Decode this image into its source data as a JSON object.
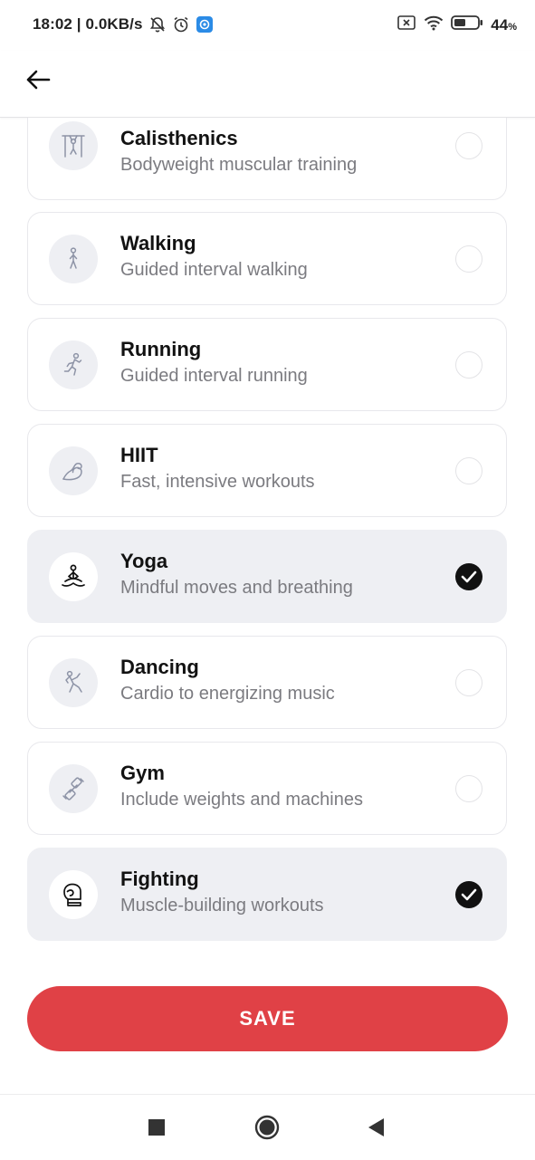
{
  "status_bar": {
    "time": "18:02",
    "speed": "0.0KB/s",
    "battery_value": "44",
    "battery_unit": "%"
  },
  "header": {
    "back_icon": "arrow-left-icon"
  },
  "workouts": [
    {
      "title": "Calisthenics",
      "subtitle": "Bodyweight muscular training",
      "icon": "pullup-bar-icon",
      "selected": false
    },
    {
      "title": "Walking",
      "subtitle": "Guided interval walking",
      "icon": "walking-person-icon",
      "selected": false
    },
    {
      "title": "Running",
      "subtitle": "Guided interval running",
      "icon": "running-person-icon",
      "selected": false
    },
    {
      "title": "HIIT",
      "subtitle": "Fast, intensive workouts",
      "icon": "flexed-arm-icon",
      "selected": false
    },
    {
      "title": "Yoga",
      "subtitle": "Mindful moves and breathing",
      "icon": "meditation-icon",
      "selected": true
    },
    {
      "title": "Dancing",
      "subtitle": "Cardio to energizing music",
      "icon": "dancer-icon",
      "selected": false
    },
    {
      "title": "Gym",
      "subtitle": "Include weights and machines",
      "icon": "dumbbell-icon",
      "selected": false
    },
    {
      "title": "Fighting",
      "subtitle": "Muscle-building workouts",
      "icon": "boxing-glove-icon",
      "selected": true
    }
  ],
  "save_button": {
    "label": "SAVE"
  },
  "colors": {
    "accent": "#e04146",
    "selected_bg": "#eeeff3",
    "check_bg": "#111111"
  }
}
